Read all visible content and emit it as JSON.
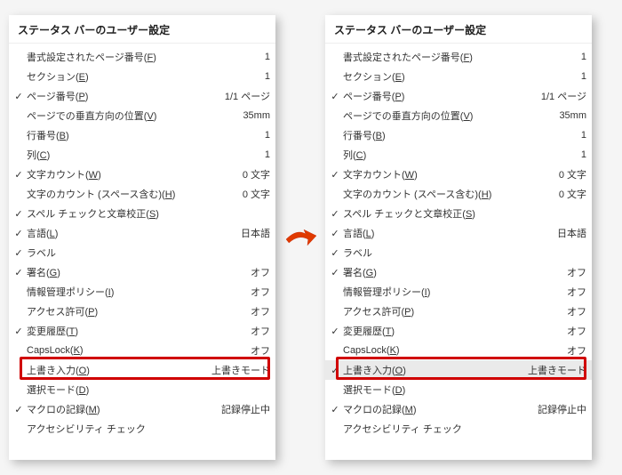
{
  "title": "ステータス バーのユーザー設定",
  "items": [
    {
      "checked": false,
      "label": "書式設定されたページ番号",
      "accel": "F",
      "value": "1"
    },
    {
      "checked": false,
      "label": "セクション",
      "accel": "E",
      "value": "1"
    },
    {
      "checked": true,
      "label": "ページ番号",
      "accel": "P",
      "value": "1/1 ページ"
    },
    {
      "checked": false,
      "label": "ページでの垂直方向の位置",
      "accel": "V",
      "value": "35mm"
    },
    {
      "checked": false,
      "label": "行番号",
      "accel": "B",
      "value": "1"
    },
    {
      "checked": false,
      "label": "列",
      "accel": "C",
      "value": "1"
    },
    {
      "checked": true,
      "label": "文字カウント",
      "accel": "W",
      "value": "0 文字"
    },
    {
      "checked": false,
      "label": "文字のカウント (スペース含む)",
      "accel": "H",
      "value": "0 文字"
    },
    {
      "checked": true,
      "label": "スペル チェックと文章校正",
      "accel": "S",
      "value": ""
    },
    {
      "checked": true,
      "label": "言語",
      "accel": "L",
      "value": "日本語"
    },
    {
      "checked": true,
      "label": "ラベル",
      "accel": "",
      "value": ""
    },
    {
      "checked": true,
      "label": "署名",
      "accel": "G",
      "value": "オフ"
    },
    {
      "checked": false,
      "label": "情報管理ポリシー",
      "accel": "I",
      "value": "オフ"
    },
    {
      "checked": false,
      "label": "アクセス許可",
      "accel": "P",
      "value": "オフ"
    },
    {
      "checked": true,
      "label": "変更履歴",
      "accel": "T",
      "value": "オフ"
    },
    {
      "checked": false,
      "label": "CapsLock",
      "accel": "K",
      "value": "オフ"
    },
    {
      "checked": false,
      "label": "上書き入力",
      "accel": "O",
      "value": "上書きモード",
      "highlight": true
    },
    {
      "checked": false,
      "label": "選択モード",
      "accel": "D",
      "value": ""
    },
    {
      "checked": true,
      "label": "マクロの記録",
      "accel": "M",
      "value": "記録停止中"
    },
    {
      "checked": false,
      "label": "アクセシビリティ チェック",
      "accel": "",
      "value": ""
    }
  ],
  "right_override": {
    "index": 16,
    "checked": true,
    "selected": true
  }
}
